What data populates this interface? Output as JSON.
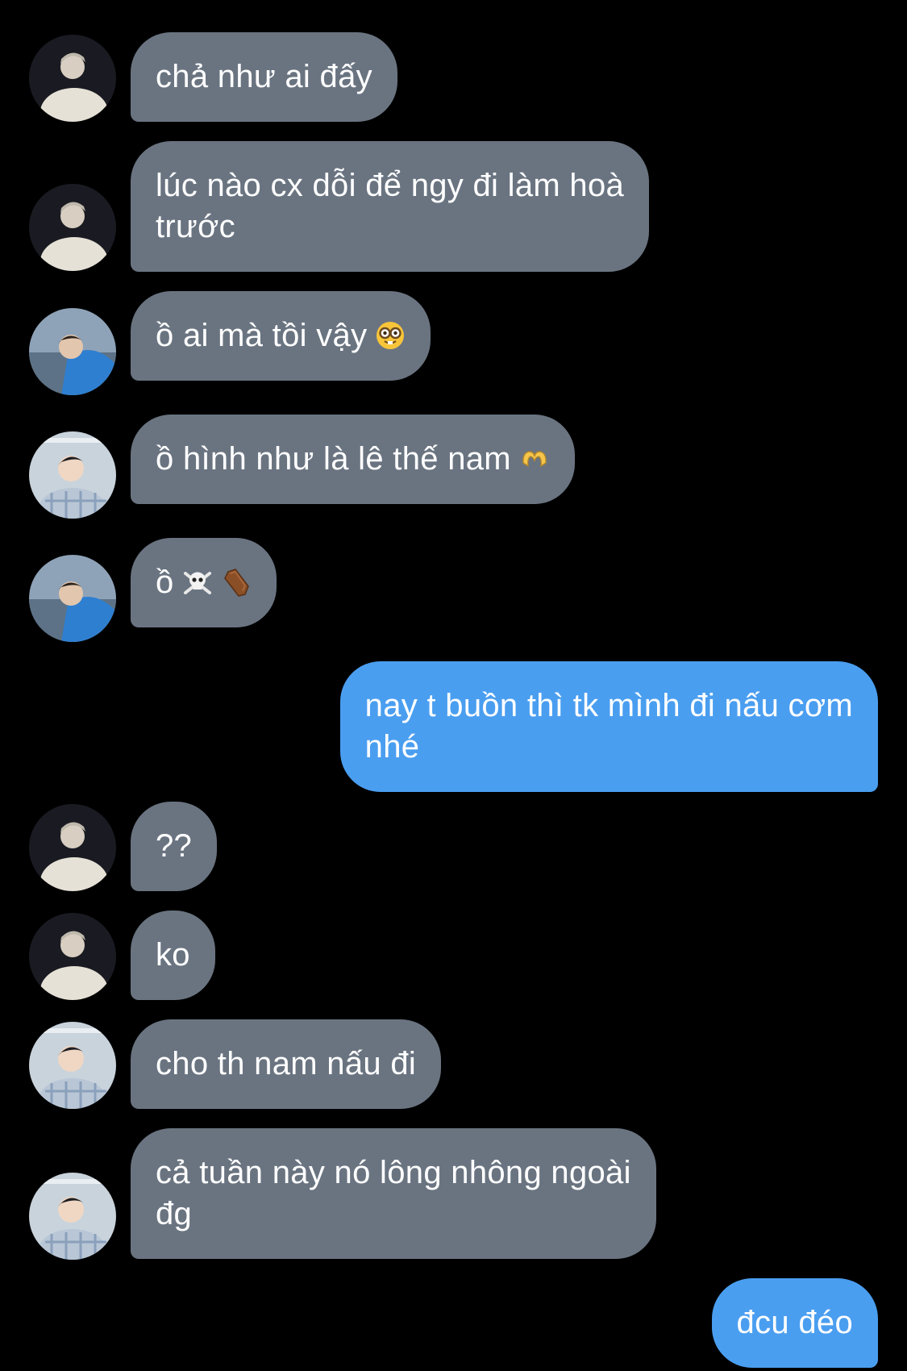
{
  "conversation": {
    "messages": [
      {
        "direction": "incoming",
        "sender_avatar": "avatar-white-coat",
        "lines": [
          "chả như ai đấy"
        ]
      },
      {
        "direction": "incoming",
        "sender_avatar": "avatar-white-coat",
        "lines": [
          "lúc nào cx dỗi để ngy đi làm hoà",
          "trước"
        ]
      },
      {
        "direction": "incoming",
        "sender_avatar": "avatar-blue-jacket",
        "lines": [
          "ồ ai mà tồi vậy"
        ],
        "emoji": "nerd-face-emoji"
      },
      {
        "direction": "incoming",
        "sender_avatar": "avatar-plaid-shirt",
        "lines": [
          "ồ hình như là lê thế nam"
        ],
        "emoji": "heart-hands-emoji"
      },
      {
        "direction": "incoming",
        "sender_avatar": "avatar-blue-jacket",
        "lines": [
          "ồ"
        ],
        "emoji": "skull-crossbones-coffin-emoji"
      },
      {
        "direction": "outgoing",
        "lines": [
          "nay t buồn thì tk mình đi nấu cơm",
          "nhé"
        ]
      },
      {
        "direction": "incoming",
        "sender_avatar": "avatar-white-coat",
        "lines": [
          "??"
        ]
      },
      {
        "direction": "incoming",
        "sender_avatar": "avatar-white-coat",
        "lines": [
          "ko"
        ]
      },
      {
        "direction": "incoming",
        "sender_avatar": "avatar-plaid-shirt",
        "lines": [
          "cho th nam nấu đi"
        ]
      },
      {
        "direction": "incoming",
        "sender_avatar": "avatar-plaid-shirt",
        "lines": [
          "cả tuần này nó lông nhông ngoài",
          "đg"
        ]
      },
      {
        "direction": "outgoing",
        "lines": [
          "đcu đéo"
        ]
      }
    ]
  },
  "colors": {
    "background": "#000000",
    "incoming_bubble": "#6a7481",
    "outgoing_bubble": "#4a9ef0",
    "text": "#ffffff"
  }
}
